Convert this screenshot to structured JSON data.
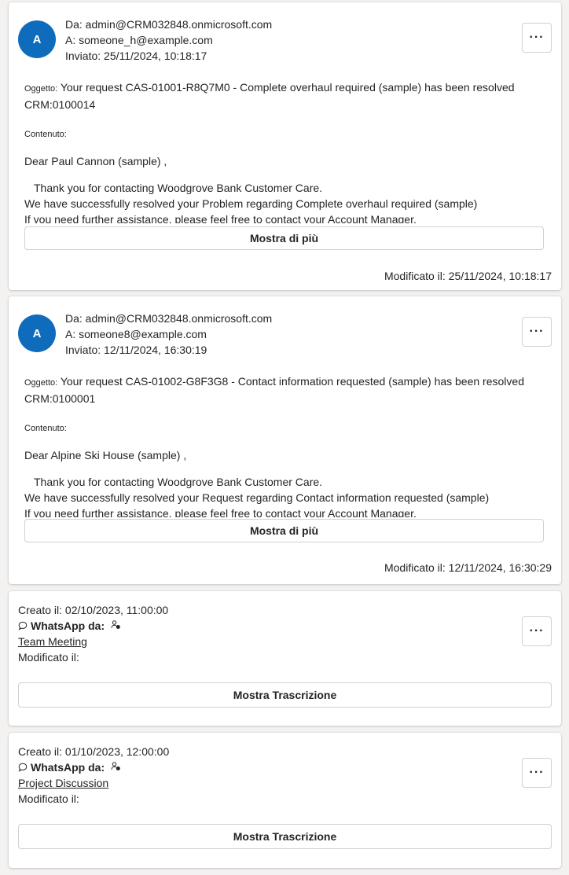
{
  "emails": [
    {
      "avatar_letter": "A",
      "from_line": "Da: admin@CRM032848.onmicrosoft.com",
      "to_line": "A: someone_h@example.com",
      "sent_line": "Inviato: 25/11/2024, 10:18:17",
      "more_label": "···",
      "subject_label": "Oggetto:",
      "subject_text": "Your request CAS-01001-R8Q7M0 - Complete overhaul required (sample) has been resolved CRM:0100014",
      "content_label": "Contenuto:",
      "greeting": "Dear Paul Cannon (sample) ,",
      "body_lines": [
        "Thank you for contacting Woodgrove Bank Customer Care.",
        "We have successfully resolved your Problem regarding Complete overhaul required (sample)",
        "If you need further assistance, please feel free to contact your Account Manager."
      ],
      "show_more_label": "Mostra di più",
      "modified_line": "Modificato il: 25/11/2024, 10:18:17"
    },
    {
      "avatar_letter": "A",
      "from_line": "Da: admin@CRM032848.onmicrosoft.com",
      "to_line": "A: someone8@example.com",
      "sent_line": "Inviato: 12/11/2024, 16:30:19",
      "more_label": "···",
      "subject_label": "Oggetto:",
      "subject_text": "Your request CAS-01002-G8F3G8 - Contact information requested (sample) has been resolved CRM:0100001",
      "content_label": "Contenuto:",
      "greeting": "Dear Alpine Ski House (sample) ,",
      "body_lines": [
        "Thank you for contacting Woodgrove Bank Customer Care.",
        "We have successfully resolved your Request regarding Contact information requested (sample)",
        "If you need further assistance, please feel free to contact your Account Manager."
      ],
      "show_more_label": "Mostra di più",
      "modified_line": "Modificato il: 12/11/2024, 16:30:29"
    }
  ],
  "whatsapp": [
    {
      "created_line": "Creato il: 02/10/2023, 11:00:00",
      "from_label": "WhatsApp da:",
      "link_text": "Team Meeting",
      "modified_line": "Modificato il:",
      "more_label": "···",
      "transcript_label": "Mostra Trascrizione"
    },
    {
      "created_line": "Creato il: 01/10/2023, 12:00:00",
      "from_label": "WhatsApp da:",
      "link_text": "Project Discussion",
      "modified_line": "Modificato il:",
      "more_label": "···",
      "transcript_label": "Mostra Trascrizione"
    }
  ],
  "colors": {
    "avatar": "#0f6cbd",
    "page_bg": "#f3f2f1",
    "border": "#d1d1d1"
  },
  "icons": {
    "chat": "chat-bubble-icon",
    "person": "person-icon",
    "more": "more-horizontal-icon"
  }
}
